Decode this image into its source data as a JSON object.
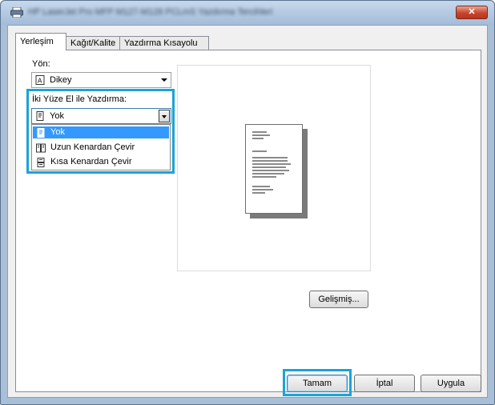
{
  "window": {
    "title": "HP LaserJet Pro MFP M127-M128 PCLmS Yazdırma Tercihleri",
    "close_label": "✕"
  },
  "tabs": [
    {
      "label": "Yerleşim",
      "active": true
    },
    {
      "label": "Kağıt/Kalite",
      "active": false
    },
    {
      "label": "Yazdırma Kısayolu",
      "active": false
    }
  ],
  "orientation": {
    "label": "Yön:",
    "value": "Dikey"
  },
  "duplex": {
    "label": "İki Yüze El ile Yazdırma:",
    "value": "Yok",
    "options": [
      {
        "label": "Yok",
        "selected": true,
        "icon": "single-page-icon"
      },
      {
        "label": "Uzun Kenardan Çevir",
        "selected": false,
        "icon": "long-edge-flip-icon"
      },
      {
        "label": "Kısa Kenardan Çevir",
        "selected": false,
        "icon": "short-edge-flip-icon"
      }
    ]
  },
  "buttons": {
    "advanced": "Gelişmiş...",
    "ok": "Tamam",
    "cancel": "İptal",
    "apply": "Uygula"
  },
  "colors": {
    "highlight": "#1aa3d9",
    "selection": "#3399ff"
  }
}
